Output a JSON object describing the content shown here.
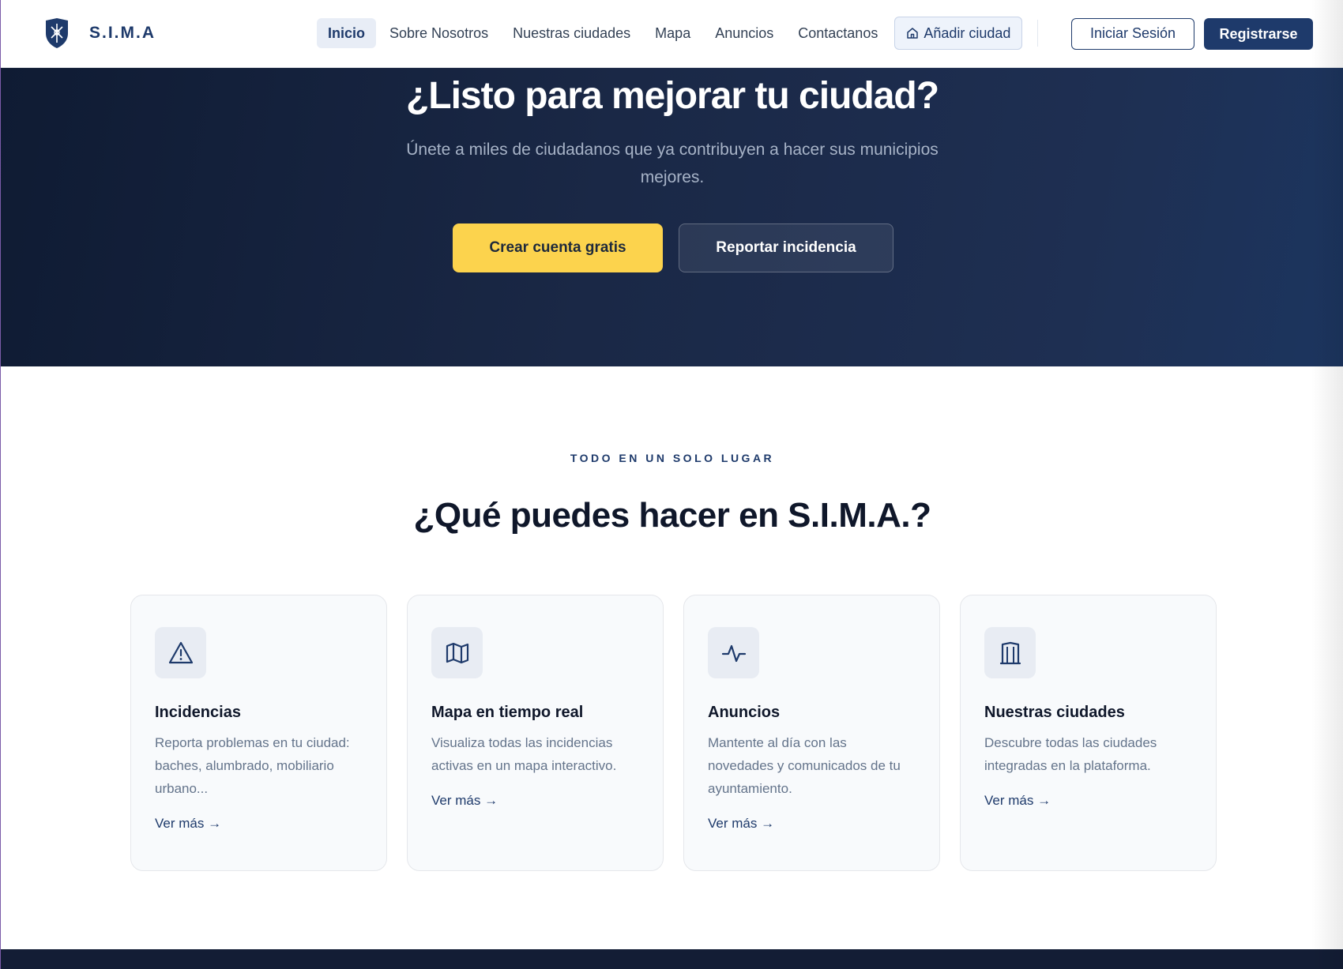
{
  "navbar": {
    "brand": "S.I.M.A",
    "links": [
      {
        "label": "Inicio",
        "active": true
      },
      {
        "label": "Sobre Nosotros"
      },
      {
        "label": "Nuestras ciudades"
      },
      {
        "label": "Mapa"
      },
      {
        "label": "Anuncios"
      },
      {
        "label": "Contactanos"
      }
    ],
    "add_city": "Añadir ciudad",
    "login": "Iniciar Sesión",
    "register": "Registrarse"
  },
  "hero": {
    "title": "¿Listo para mejorar tu ciudad?",
    "subtitle": "Únete a miles de ciudadanos que ya contribuyen a hacer sus municipios mejores.",
    "primary_button": "Crear cuenta gratis",
    "secondary_button": "Reportar incidencia"
  },
  "features": {
    "eyebrow": "TODO EN UN SOLO LUGAR",
    "title": "¿Qué puedes hacer en S.I.M.A.?",
    "cards": [
      {
        "icon": "warning-icon",
        "title": "Incidencias",
        "description": "Reporta problemas en tu ciudad: baches, alumbrado, mobiliario urbano...",
        "link": "Ver más →"
      },
      {
        "icon": "map-icon",
        "title": "Mapa en tiempo real",
        "description": "Visualiza todas las incidencias activas en un mapa interactivo.",
        "link": "Ver más →"
      },
      {
        "icon": "activity-icon",
        "title": "Anuncios",
        "description": "Mantente al día con las novedades y comunicados de tu ayuntamiento.",
        "link": "Ver más →"
      },
      {
        "icon": "building-icon",
        "title": "Nuestras ciudades",
        "description": "Descubre todas las ciudades integradas en la plataforma.",
        "link": "Ver más →"
      }
    ]
  },
  "colors": {
    "brand": "#1e3a6b",
    "accent": "#fcd34d",
    "hero_bg": "#1a2846"
  }
}
